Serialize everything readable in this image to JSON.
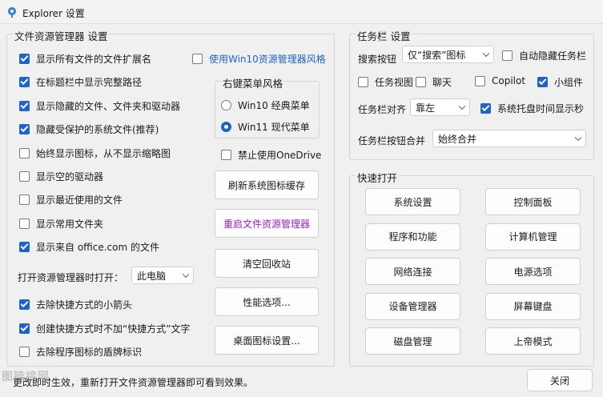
{
  "window": {
    "title": "Explorer 设置"
  },
  "explorer": {
    "title": "文件资源管理器 设置",
    "checks": [
      {
        "label": "显示所有文件的文件扩展名",
        "checked": true
      },
      {
        "label": "在标题栏中显示完整路径",
        "checked": true
      },
      {
        "label": "显示隐藏的文件、文件夹和驱动器",
        "checked": true
      },
      {
        "label": "隐藏受保护的系统文件(推荐)",
        "checked": true
      },
      {
        "label": "始终显示图标，从不显示缩略图",
        "checked": false
      },
      {
        "label": "显示空的驱动器",
        "checked": false
      },
      {
        "label": "显示最近使用的文件",
        "checked": false
      },
      {
        "label": "显示常用文件夹",
        "checked": false
      },
      {
        "label": "显示来自 office.com 的文件",
        "checked": true
      }
    ],
    "open_label": "打开资源管理器时打开：",
    "open_value": "此电脑",
    "shortcut_checks": [
      {
        "label": "去除快捷方式的小箭头",
        "checked": true
      },
      {
        "label": "创建快捷方式时不加“快捷方式”文字",
        "checked": true
      },
      {
        "label": "去除程序图标的盾牌标识",
        "checked": false
      }
    ],
    "win10_explorer": {
      "label": "使用Win10资源管理器风格",
      "checked": false
    },
    "context_menu": {
      "title": "右键菜单风格",
      "options": [
        {
          "label": "Win10 经典菜单",
          "selected": false
        },
        {
          "label": "Win11 现代菜单",
          "selected": true
        }
      ]
    },
    "onedrive": {
      "label": "禁止使用OneDrive",
      "checked": false
    },
    "buttons": [
      "刷新系统图标缓存",
      "重启文件资源管理器",
      "清空回收站",
      "性能选项...",
      "桌面图标设置..."
    ]
  },
  "taskbar": {
    "title": "任务栏 设置",
    "search_label": "搜索按钮",
    "search_value": "仅“搜索”图标",
    "autohide": {
      "label": "自动隐藏任务栏",
      "checked": false
    },
    "items": [
      {
        "label": "任务视图",
        "checked": false
      },
      {
        "label": "聊天",
        "checked": false
      },
      {
        "label": "Copilot",
        "checked": false
      },
      {
        "label": "小组件",
        "checked": true
      }
    ],
    "align_label": "任务栏对齐",
    "align_value": "靠左",
    "tray_seconds": {
      "label": "系统托盘时间显示秒",
      "checked": true
    },
    "merge_label": "任务栏按钮合并",
    "merge_value": "始终合并"
  },
  "quick": {
    "title": "快速打开",
    "buttons": [
      "系统设置",
      "控制面板",
      "程序和功能",
      "计算机管理",
      "网络连接",
      "电源选项",
      "设备管理器",
      "屏幕键盘",
      "磁盘管理",
      "上帝模式"
    ]
  },
  "footer": {
    "status": "更改即时生效，重新打开文件资源管理器即可看到效果。",
    "close": "关闭",
    "watermark": "图链接网"
  },
  "colors": {
    "accent": "#1f63c4",
    "purple": "#9b1fbf"
  }
}
